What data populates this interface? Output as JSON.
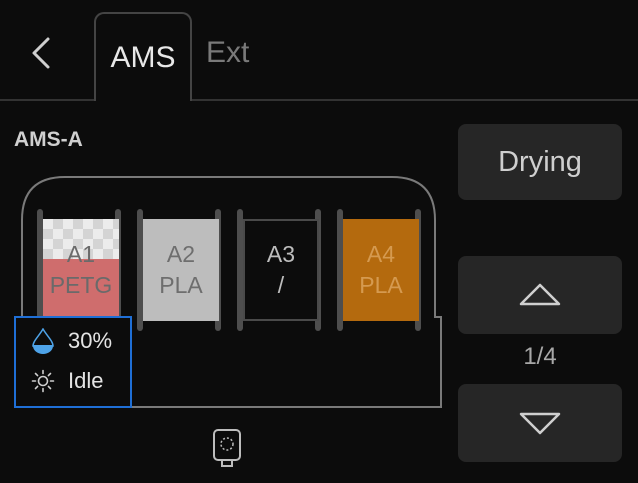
{
  "header": {
    "back_icon": "chevron-left-icon",
    "tabs": [
      {
        "label": "AMS",
        "active": true
      },
      {
        "label": "Ext",
        "active": false
      }
    ]
  },
  "ams": {
    "name": "AMS-A",
    "slots": [
      {
        "id": "A1",
        "material": "PETG",
        "color": "#cf6d6d",
        "pattern": "checkered-top"
      },
      {
        "id": "A2",
        "material": "PLA",
        "color": "#bdbdbd"
      },
      {
        "id": "A3",
        "material": "/",
        "color": "empty"
      },
      {
        "id": "A4",
        "material": "PLA",
        "color": "#b46a0e"
      }
    ],
    "humidity": {
      "value": "30%",
      "icon": "water-drop-icon"
    },
    "status": {
      "value": "Idle",
      "icon": "sun-icon"
    }
  },
  "sidebar": {
    "drying_label": "Drying",
    "up_icon": "triangle-up-icon",
    "page_indicator": "1/4",
    "down_icon": "triangle-down-icon"
  },
  "colors": {
    "background": "#0c0c0c",
    "button": "#262626",
    "selection": "#1f6fd6",
    "humidity_drop": "#4ea3e8"
  }
}
